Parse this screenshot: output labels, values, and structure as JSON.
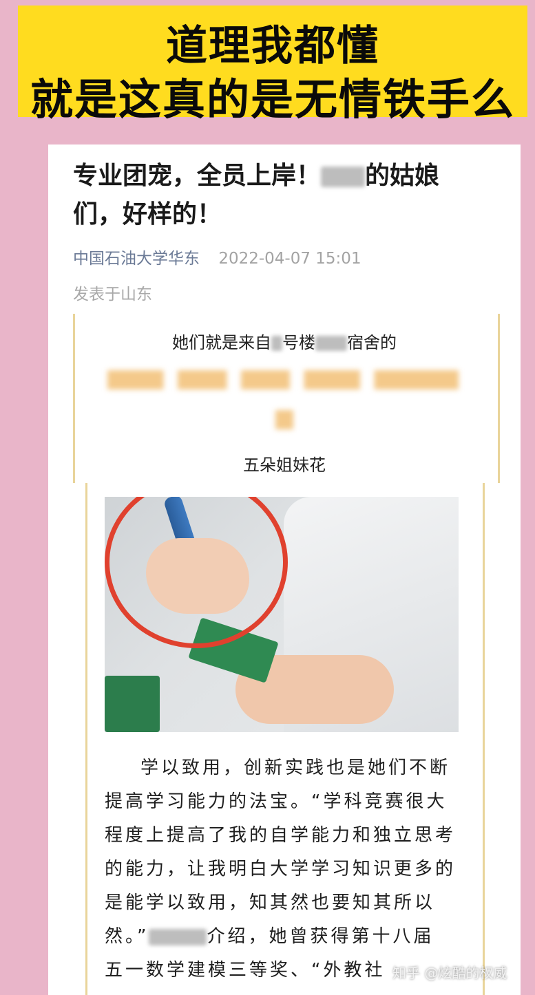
{
  "banner": {
    "line1": "道理我都懂",
    "line2": "就是这真的是无情铁手么"
  },
  "article": {
    "title_part1": "专业团宠，全员上岸！",
    "title_part2": "的姑娘",
    "title_line2": "们，好样的！",
    "source": "中国石油大学华东",
    "time": "2022-04-07 15:01",
    "location": "发表于山东",
    "intro_a": "她们就是来自",
    "intro_b": "号楼",
    "intro_c": "宿舍的",
    "sisters": "五朵姐妹花",
    "paragraph": [
      "学以致用，创新实践也是她们不断",
      "提高学习能力的法宝。“学科竞赛很大",
      "程度上提高了我的自学能力和独立思考",
      "的能力，让我明白大学学习知识更多的",
      "是能学以致用，知其然也要知其所以",
      "然。”",
      "介绍，她曾获得第十八届",
      "五一数学建模三等奖、“外教社"
    ]
  },
  "watermark": "知乎 @炫酷的权威",
  "colors": {
    "background": "#e9b5c9",
    "banner": "#ffdc1f",
    "frame": "#e9d49a",
    "circle": "#e0412e"
  }
}
